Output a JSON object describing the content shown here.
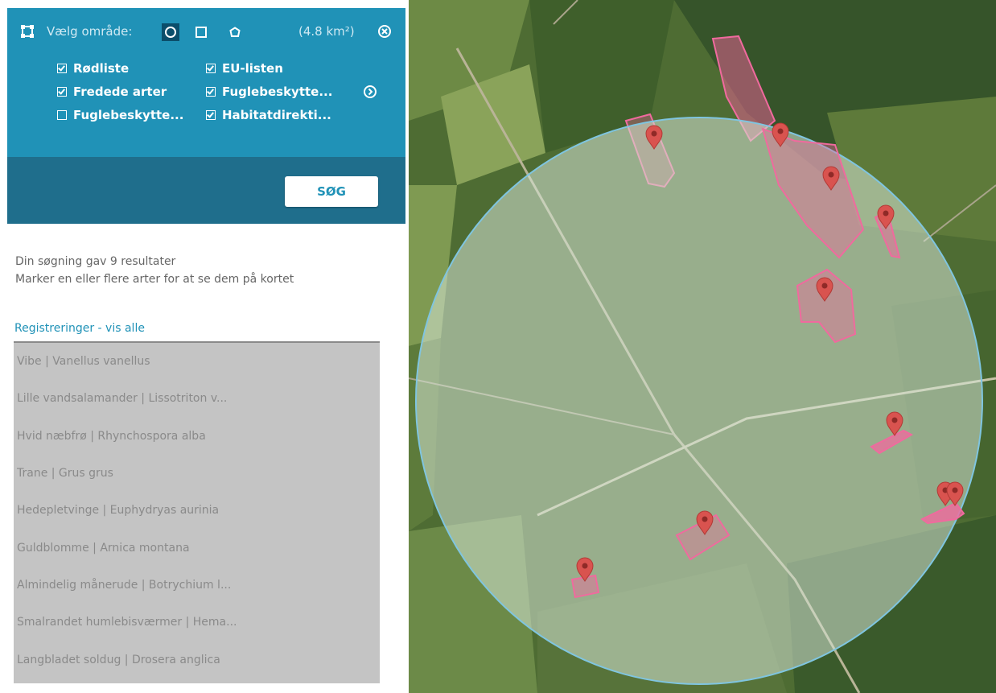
{
  "filter": {
    "select_area_label": "Vælg område:",
    "area_size": "(4.8 km²)",
    "checkboxes": [
      {
        "label": "Rødliste",
        "checked": true
      },
      {
        "label": "EU-listen",
        "checked": true
      },
      {
        "label": "Fredede arter",
        "checked": true
      },
      {
        "label": "Fuglebeskytte...",
        "checked": true
      },
      {
        "label": "Fuglebeskytte...",
        "checked": false
      },
      {
        "label": "Habitatdirekti...",
        "checked": true
      }
    ]
  },
  "search_button": "SØG",
  "results_info": {
    "line1": "Din søgning gav 9 resultater",
    "line2": "Marker en eller flere arter for at se dem på kortet"
  },
  "registrations_link": "Registreringer - vis alle",
  "results": [
    "Vibe | Vanellus vanellus",
    "Lille vandsalamander | Lissotriton v...",
    "Hvid næbfrø | Rhynchospora alba",
    "Trane | Grus grus",
    "Hedepletvinge | Euphydryas aurinia",
    "Guldblomme | Arnica montana",
    "Almindelig månerude | Botrychium l...",
    "Smalrandet humlebisværmer | Hema...",
    "Langbladet soldug | Drosera anglica"
  ],
  "colors": {
    "panel_blue": "#2092b7",
    "panel_dark": "#1f6e8c",
    "result_bg": "#c4c4c4",
    "marker": "#d9534f",
    "area_pink": "#f06a9e"
  },
  "icons": {
    "select_area": "area-select-icon",
    "circle_shape": "circle-shape-icon",
    "square_shape": "square-shape-icon",
    "polygon_shape": "polygon-shape-icon",
    "clear": "close-circle-icon",
    "more": "chevron-right-circle-icon",
    "marker": "map-marker-icon"
  }
}
